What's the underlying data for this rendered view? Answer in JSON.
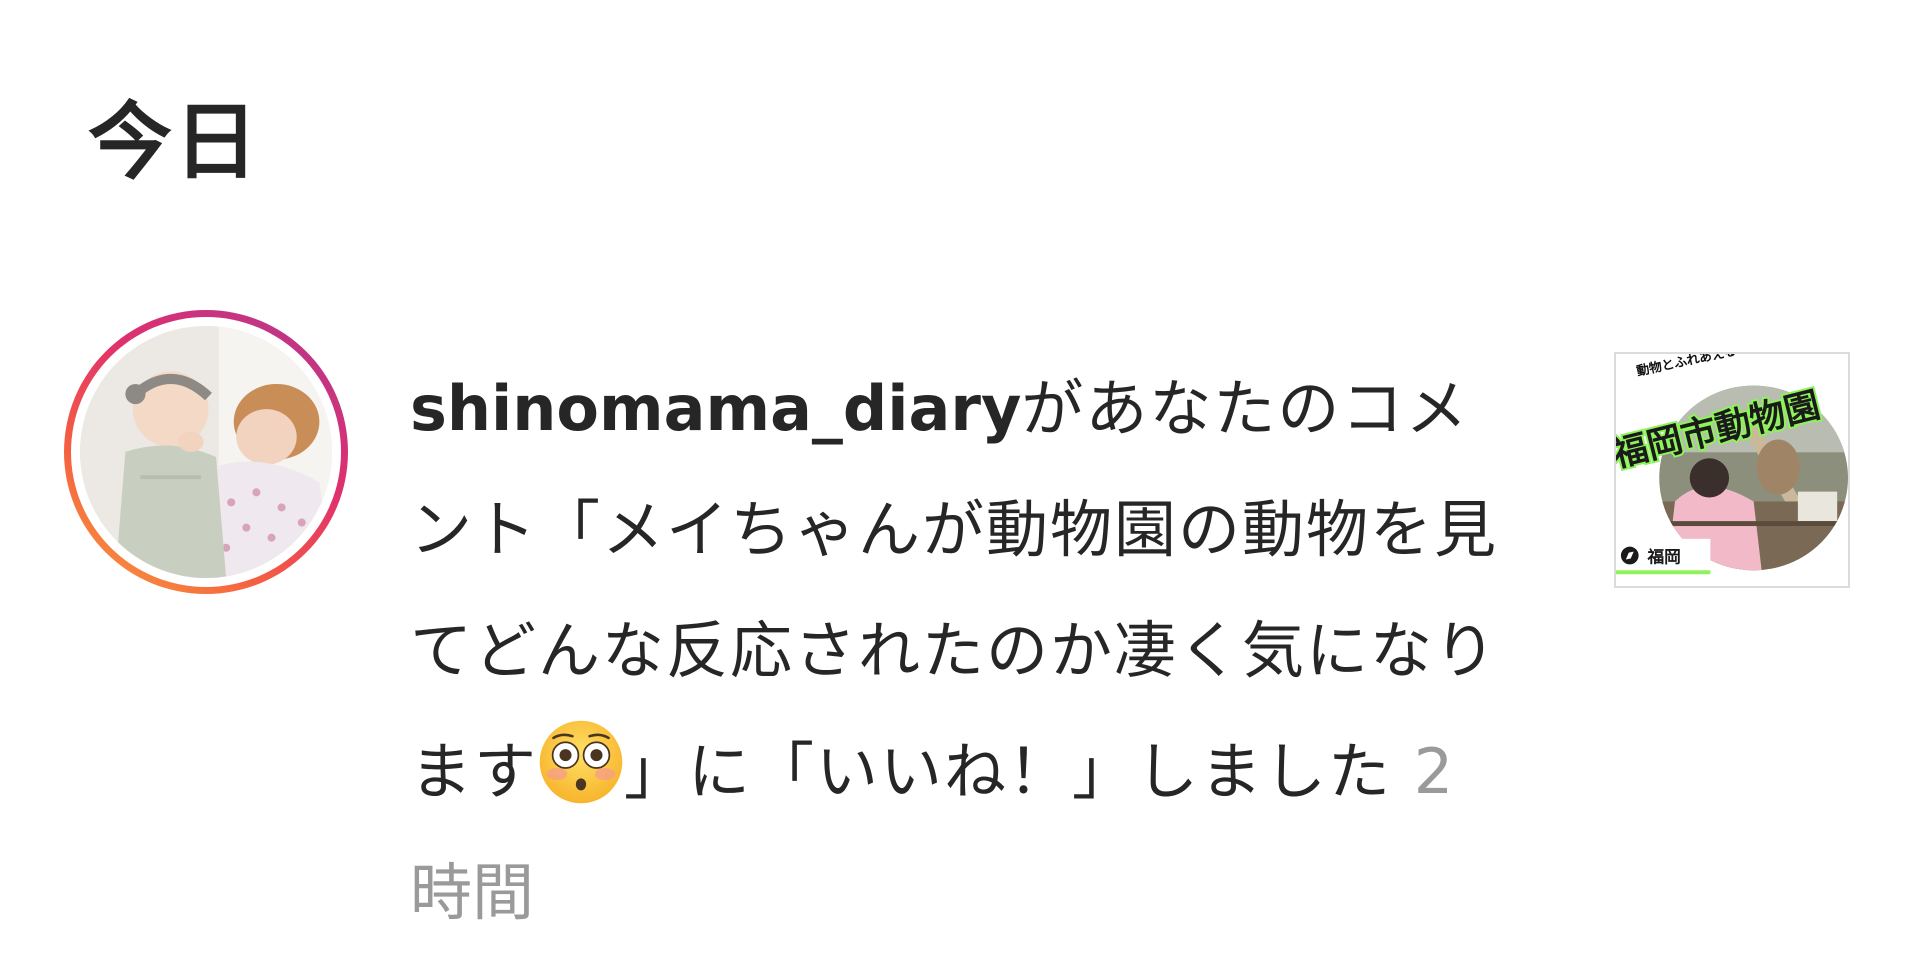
{
  "section": {
    "heading": "今日"
  },
  "notification": {
    "avatar": {
      "icon": "profile-photo",
      "ring_colors": [
        "#f9a33c",
        "#f56040",
        "#e1306c",
        "#c13584"
      ]
    },
    "username": "shinomama_diary",
    "text_before_emoji": "があなたのコメント「メイちゃんが動物園の動物を見てどんな反応されたのか凄く気になります",
    "emoji": "flushed-face-emoji",
    "text_after_emoji": "」に「いいね！」しました ",
    "time": "2時間",
    "post_thumbnail": {
      "caption_small": "動物とふれあえる",
      "title": "福岡市動物園",
      "location_icon": "compass-icon",
      "location": "福岡"
    }
  }
}
